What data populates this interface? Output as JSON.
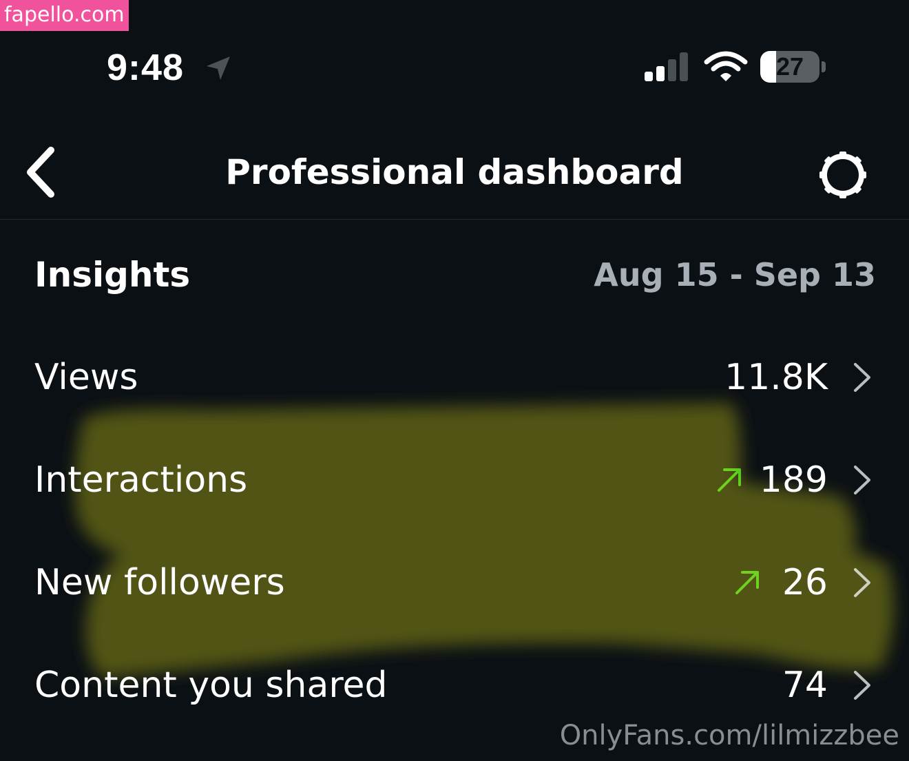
{
  "watermark_top": "fapello.com",
  "watermark_bottom": "OnlyFans.com/lilmizzbee",
  "status_bar": {
    "time": "9:48",
    "location_icon": "location-arrow-icon",
    "signal_icon": "cellular-signal-icon",
    "signal_bars_active": 2,
    "signal_bars_total": 4,
    "wifi_icon": "wifi-icon",
    "battery_icon": "battery-icon",
    "battery_level": "27",
    "battery_fraction": 0.27
  },
  "header": {
    "back_icon": "chevron-left-icon",
    "title": "Professional dashboard",
    "settings_icon": "gear-icon"
  },
  "insights": {
    "title": "Insights",
    "date_range": "Aug 15 - Sep 13"
  },
  "metrics": [
    {
      "label": "Views",
      "value": "11.8K",
      "trend": null
    },
    {
      "label": "Interactions",
      "value": "189",
      "trend": "up-arrow-icon"
    },
    {
      "label": "New followers",
      "value": "26",
      "trend": "up-arrow-icon"
    },
    {
      "label": "Content you shared",
      "value": "74",
      "trend": null
    }
  ],
  "colors": {
    "background": "#0b1014",
    "text": "#ffffff",
    "secondary_text": "#a8afb6",
    "trend_up": "#34c01f",
    "highlighter": "#e8e600",
    "watermark_badge": "#f0529c"
  }
}
